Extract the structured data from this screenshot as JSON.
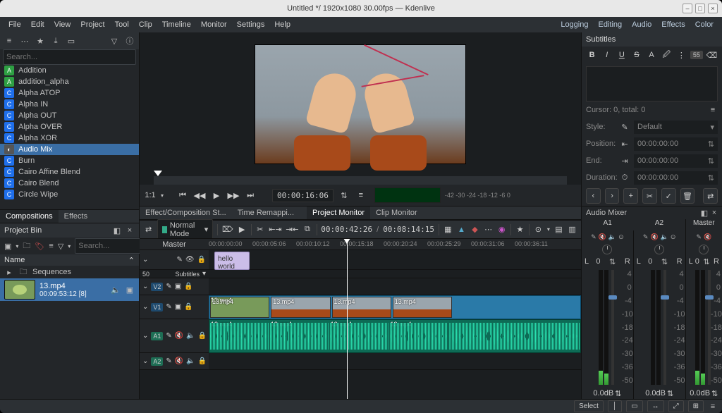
{
  "title": "Untitled */ 1920x1080 30.00fps — Kdenlive",
  "menubar": [
    "File",
    "Edit",
    "View",
    "Project",
    "Tool",
    "Clip",
    "Timeline",
    "Monitor",
    "Settings",
    "Help"
  ],
  "menubar_right": [
    "Logging",
    "Editing",
    "Audio",
    "Effects",
    "Color"
  ],
  "effect_search_placeholder": "Search...",
  "effects": [
    {
      "label": "Addition",
      "badge": "A",
      "color": "#2ea043"
    },
    {
      "label": "addition_alpha",
      "badge": "A",
      "color": "#2ea043"
    },
    {
      "label": "Alpha ATOP",
      "badge": "C",
      "color": "#1f6feb"
    },
    {
      "label": "Alpha IN",
      "badge": "C",
      "color": "#1f6feb"
    },
    {
      "label": "Alpha OUT",
      "badge": "C",
      "color": "#1f6feb"
    },
    {
      "label": "Alpha OVER",
      "badge": "C",
      "color": "#1f6feb"
    },
    {
      "label": "Alpha XOR",
      "badge": "C",
      "color": "#1f6feb"
    },
    {
      "label": "Audio Mix",
      "badge": "◐",
      "color": "#555"
    },
    {
      "label": "Burn",
      "badge": "C",
      "color": "#1f6feb"
    },
    {
      "label": "Cairo Affine Blend",
      "badge": "C",
      "color": "#1f6feb"
    },
    {
      "label": "Cairo Blend",
      "badge": "C",
      "color": "#1f6feb"
    },
    {
      "label": "Circle Wipe",
      "badge": "C",
      "color": "#1f6feb"
    }
  ],
  "left_tabs": [
    "Compositions",
    "Effects"
  ],
  "left_tabs_active": 0,
  "center_bottom_tabs_left": [
    "Effect/Composition St...",
    "Time Remappi..."
  ],
  "center_bottom_tabs_right": [
    "Project Monitor",
    "Clip Monitor"
  ],
  "projectbin": {
    "title": "Project Bin",
    "col": "Name",
    "search_placeholder": "Search...",
    "folder": "Sequences",
    "items": [
      {
        "name": "13.mp4",
        "dur": "00:09:53:12 [8]"
      }
    ]
  },
  "monitor": {
    "zoom": "1:1",
    "timecode": "00:00:16:06",
    "scope_labels": "-42  -30 -24 -18 -12  -6   0"
  },
  "tlbar": {
    "mode": "Normal Mode",
    "pos": "00:00:42:26",
    "dur": "00:08:14:15"
  },
  "timeline": {
    "master": "Master",
    "subtitles": "Subtitles",
    "ticks": [
      "00:00:00:00",
      "00:00:05:06",
      "00:00:10:12",
      "00:00:15:18",
      "00:00:20:24",
      "00:00:25:29",
      "00:00:31:06",
      "00:00:36:11"
    ],
    "subtitle_clip": "hello world",
    "zoomval": "50",
    "tracks": {
      "v2": "V2",
      "v1": "V1",
      "a1": "A1",
      "a2": "A2"
    },
    "clip_name": "13.mp4"
  },
  "subtitles": {
    "title": "Subtitles",
    "count": "55",
    "cursor": "Cursor: 0, total: 0",
    "style_label": "Style:",
    "style_value": "Default",
    "position_label": "Position:",
    "end_label": "End:",
    "duration_label": "Duration:",
    "tc_zero": "00:00:00:00"
  },
  "mixer": {
    "title": "Audio Mixer",
    "ch_labels": [
      "A1",
      "A2"
    ],
    "master_label": "Master",
    "pan": {
      "L": "L",
      "zero": "0",
      "R": "R"
    },
    "scale": [
      "4",
      "0",
      "-4",
      "-10",
      "-18",
      "-24",
      "-30",
      "-36",
      "-50"
    ],
    "db": "0.0dB"
  },
  "status": {
    "select": "Select"
  }
}
